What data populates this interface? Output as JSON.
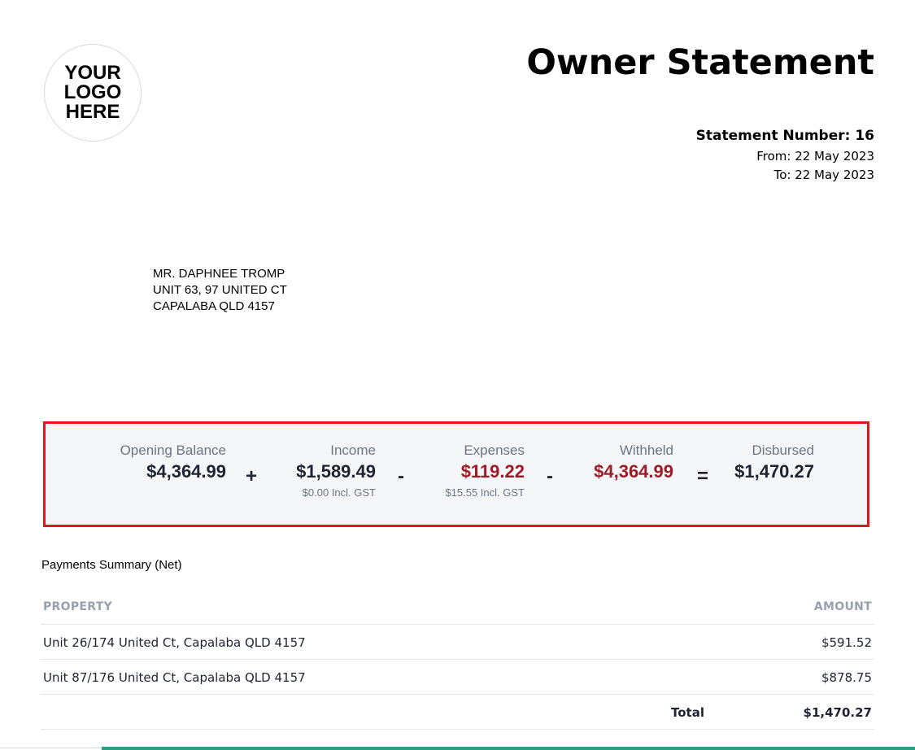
{
  "logo": {
    "text": "YOUR\nLOGO\nHERE"
  },
  "header": {
    "title": "Owner Statement",
    "statement_number": "Statement Number: 16",
    "from": "From: 22 May 2023",
    "to": "To: 22 May 2023"
  },
  "address": {
    "lines": [
      "MR. DAPHNEE TROMP",
      "UNIT 63, 97 UNITED CT",
      "CAPALABA QLD 4157"
    ]
  },
  "summary": {
    "opening_balance": {
      "label": "Opening Balance",
      "value": "$4,364.99"
    },
    "income": {
      "label": "Income",
      "value": "$1,589.49",
      "gst": "$0.00 Incl. GST"
    },
    "expenses": {
      "label": "Expenses",
      "value": "$119.22",
      "gst": "$15.55 Incl. GST"
    },
    "withheld": {
      "label": "Withheld",
      "value": "$4,364.99"
    },
    "disbursed": {
      "label": "Disbursed",
      "value": "$1,470.27"
    },
    "operators": [
      "+",
      "-",
      "-",
      "="
    ],
    "colors": {
      "negative": "#9e1c28",
      "highlight_border": "#e0171d"
    }
  },
  "payments": {
    "title": "Payments Summary (Net)",
    "headers": {
      "property": "PROPERTY",
      "amount": "AMOUNT"
    },
    "rows": [
      {
        "property": "Unit 26/174 United Ct, Capalaba QLD 4157",
        "amount": "$591.52"
      },
      {
        "property": "Unit 87/176 United Ct, Capalaba QLD 4157",
        "amount": "$878.75"
      }
    ],
    "total_label": "Total",
    "total_amount": "$1,470.27"
  }
}
